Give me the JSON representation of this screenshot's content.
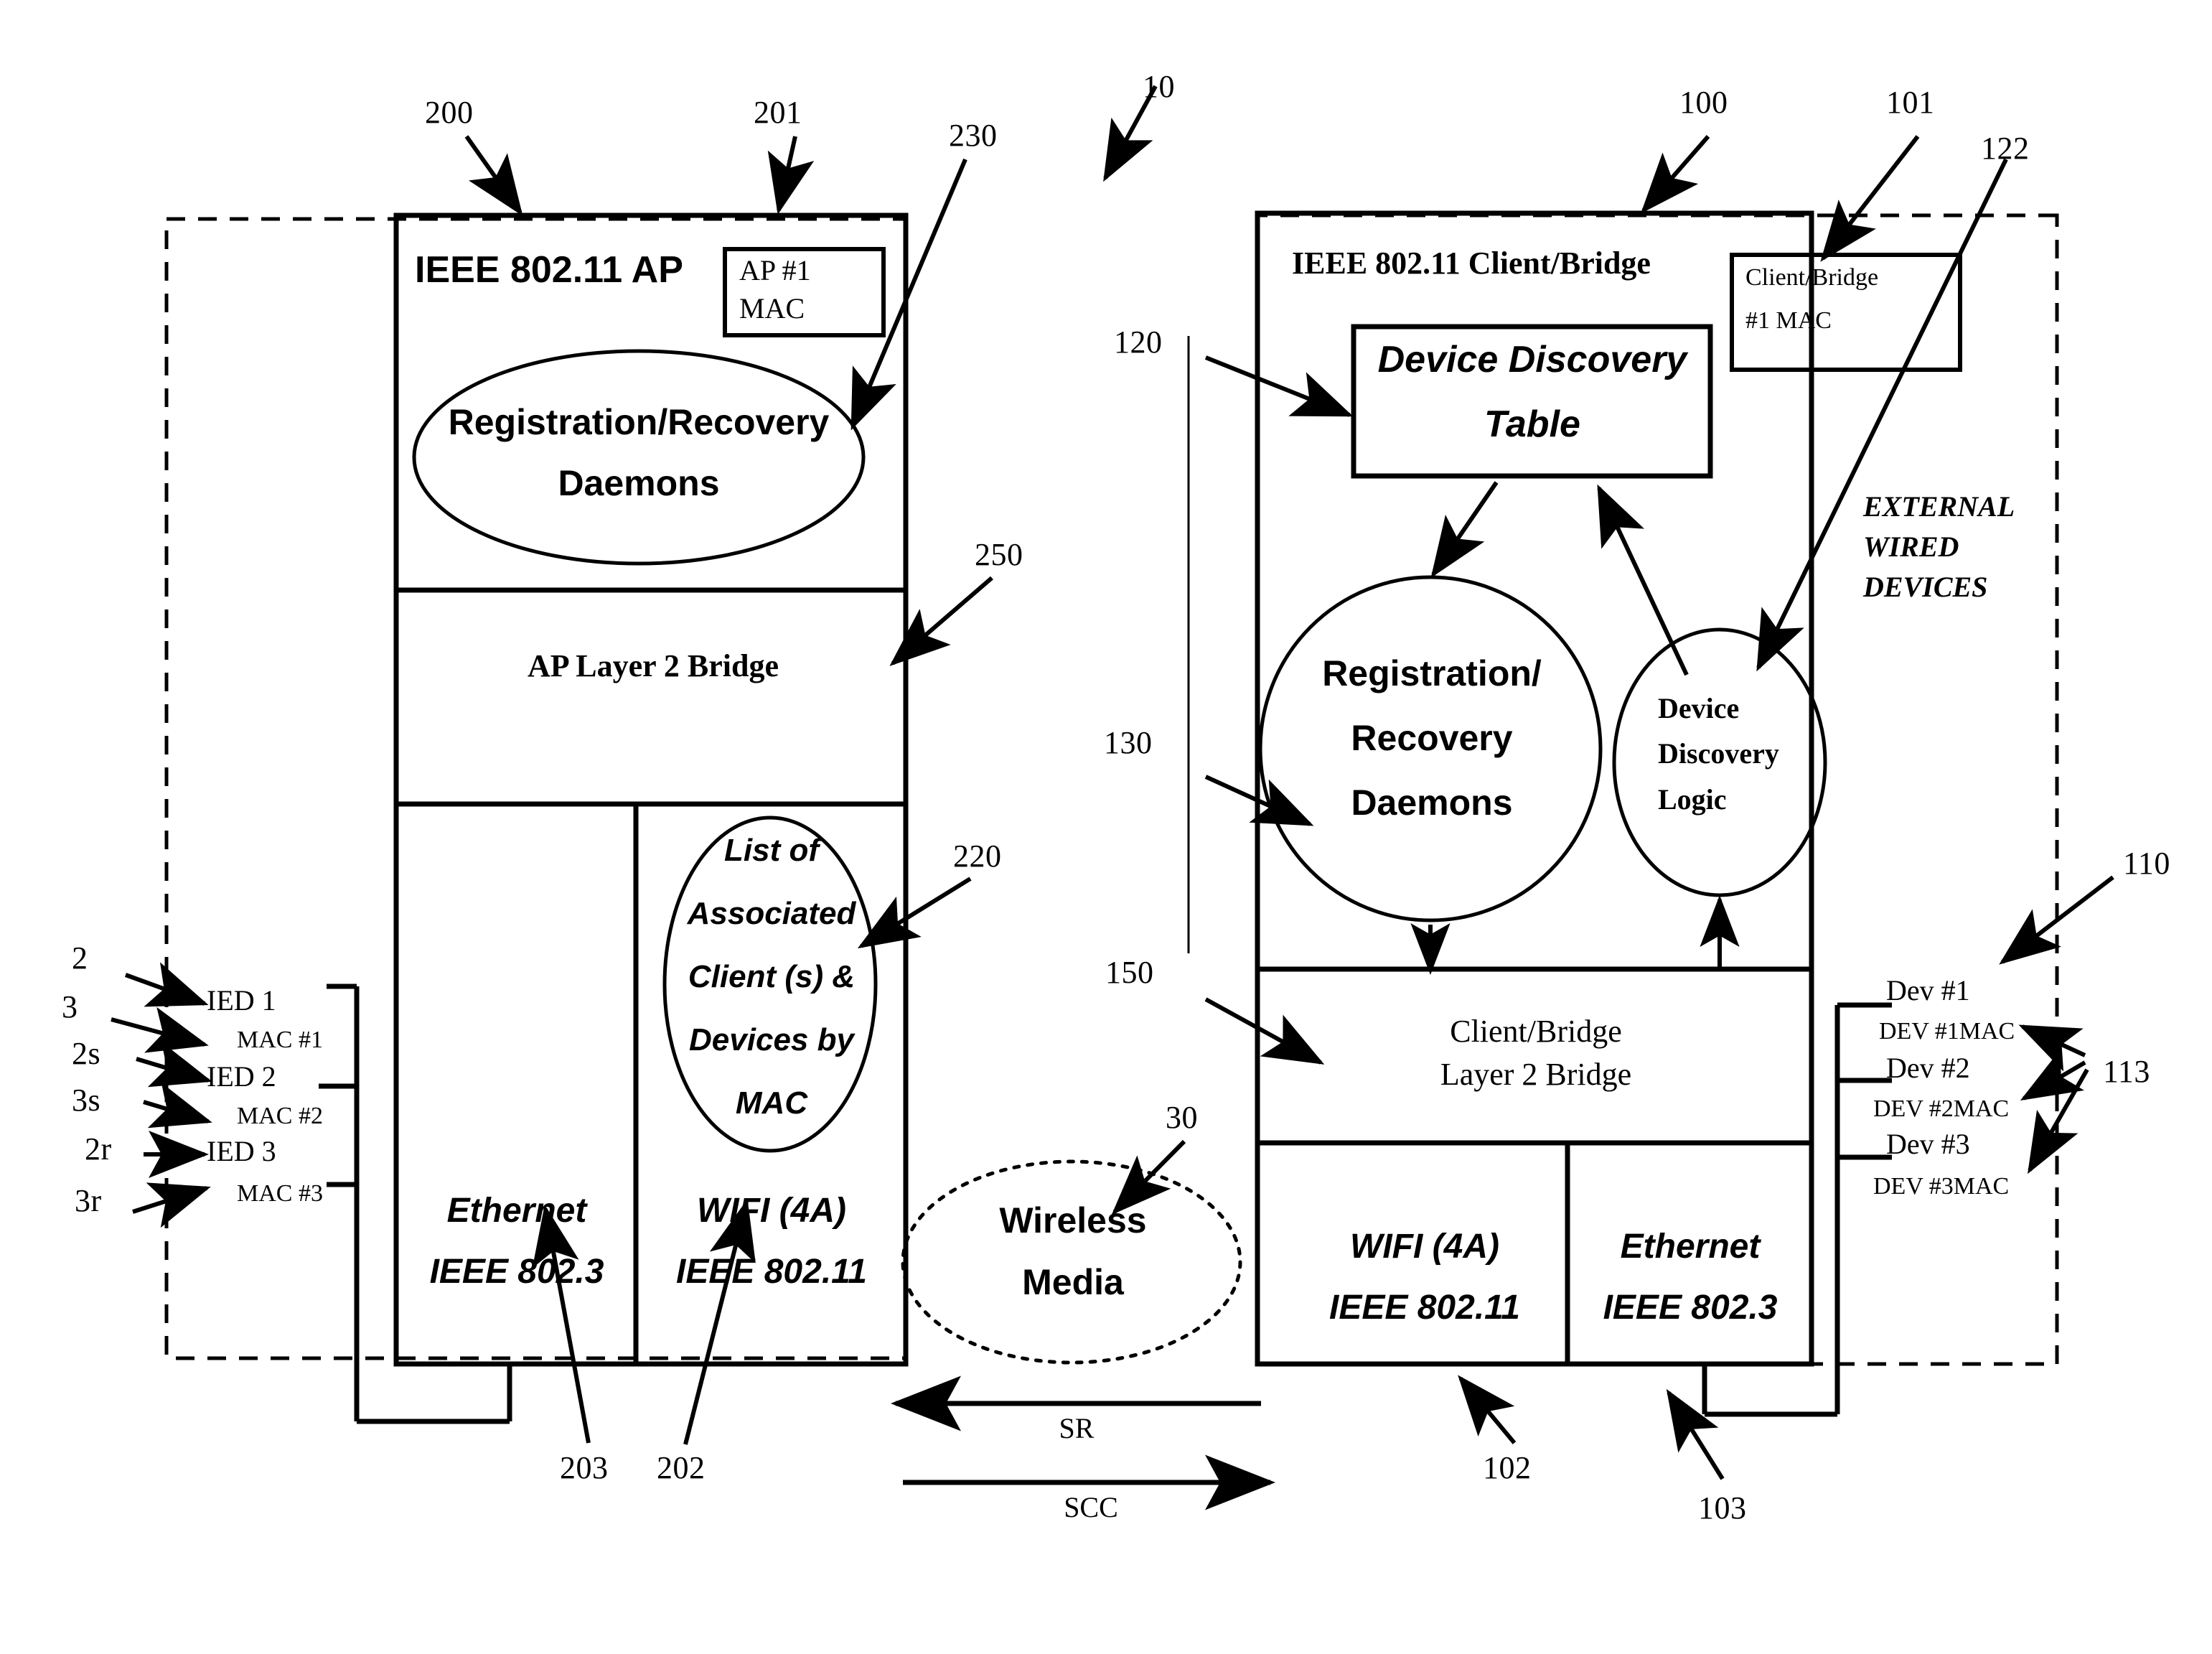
{
  "figure": {
    "title": "IEEE 802.11 AP and Client/Bridge architecture",
    "system_ref": "10"
  },
  "ap_side": {
    "outer_ref": "200",
    "header": "IEEE 802.11 AP",
    "mac_box": {
      "ref": "201",
      "line1": "AP #1",
      "line2": "MAC"
    },
    "daemons": {
      "ref": "230",
      "line1": "Registration/Recovery",
      "line2": "Daemons"
    },
    "bridge": {
      "ref": "250",
      "label": "AP Layer 2 Bridge"
    },
    "client_list": {
      "ref": "220",
      "line1": "List of",
      "line2": "Associated",
      "line3": "Client (s) &",
      "line4": "Devices by",
      "line5": "MAC"
    },
    "ethernet_port": {
      "ref": "203",
      "line1": "Ethernet",
      "line2": "IEEE 802.3"
    },
    "wifi_port": {
      "ref": "202",
      "line1": "WIFI (4A)",
      "line2": "IEEE 802.11"
    }
  },
  "ieds": [
    {
      "arrow_ref": "2",
      "name": "IED 1",
      "mac_arrow_ref": "3",
      "mac": "MAC #1"
    },
    {
      "arrow_ref": "2s",
      "name": "IED 2",
      "mac_arrow_ref": "3s",
      "mac": "MAC #2"
    },
    {
      "arrow_ref": "2r",
      "name": "IED 3",
      "mac_arrow_ref": "3r",
      "mac": "MAC #3"
    }
  ],
  "media": {
    "ref": "30",
    "line1": "Wireless",
    "line2": "Media",
    "signal_up": "SR",
    "signal_down": "SCC"
  },
  "client_side": {
    "outer_ref": "100",
    "header": "IEEE 802.11 Client/Bridge",
    "mac_box": {
      "ref": "101",
      "line1": "Client/Bridge",
      "line2": "#1 MAC"
    },
    "discovery_table": {
      "ref": "120",
      "line1": "Device Discovery",
      "line2": "Table"
    },
    "daemons": {
      "ref": "130",
      "line1": "Registration/",
      "line2": "Recovery",
      "line3": "Daemons"
    },
    "discovery_logic": {
      "ref": "122",
      "line1": "Device",
      "line2": "Discovery",
      "line3": "Logic"
    },
    "bridge": {
      "ref": "150",
      "line1": "Client/Bridge",
      "line2": "Layer 2 Bridge"
    },
    "wifi_port": {
      "ref": "102",
      "line1": "WIFI (4A)",
      "line2": "IEEE 802.11"
    },
    "ethernet_port": {
      "ref": "103",
      "line1": "Ethernet",
      "line2": "IEEE 802.3"
    },
    "external_label": {
      "line1": "EXTERNAL",
      "line2": "WIRED",
      "line3": "DEVICES"
    }
  },
  "devices": {
    "boundary_ref": "110",
    "group_ref": "113",
    "items": [
      {
        "name": "Dev #1",
        "mac": "DEV #1MAC"
      },
      {
        "name": "Dev #2",
        "mac": "DEV #2MAC"
      },
      {
        "name": "Dev #3",
        "mac": "DEV #3MAC"
      }
    ]
  },
  "colors": {
    "ink": "#000000",
    "paper": "#ffffff"
  }
}
